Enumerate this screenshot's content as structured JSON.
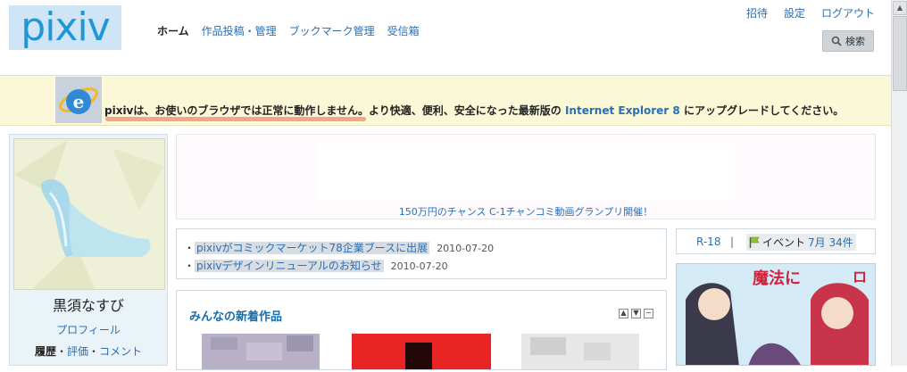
{
  "header": {
    "logo_text": "pixiv",
    "nav": [
      "ホーム",
      "作品投稿・管理",
      "ブックマーク管理",
      "受信箱"
    ],
    "toplinks": [
      "招待",
      "設定",
      "ログアウト"
    ],
    "search_label": "検索"
  },
  "notice": {
    "text_before": "pixivは、お使いのブラウザでは正常に動作しません。より快適、便利、安全になった最新版の ",
    "browser_link": "Internet Explorer 8",
    "text_after": " にアップグレードしてください。"
  },
  "profile": {
    "username": "黒須なすび",
    "profile_link": "プロフィール",
    "history": "履歴",
    "rating": "評価",
    "comment": "コメント",
    "sep": "・"
  },
  "ad": {
    "text": "150万円のチャンス C-1チャンコミ動画グランプリ開催！"
  },
  "news": [
    {
      "title": "pixivがコミックマーケット78企業ブースに出展",
      "date": "2010-07-20"
    },
    {
      "title": "pixivデザインリニューアルのお知らせ",
      "date": "2010-07-20"
    }
  ],
  "works": {
    "title": "みんなの新着作品"
  },
  "right": {
    "r18": "R-18",
    "sep": "|",
    "event_label": "イベント",
    "event_count": "7月 34件"
  },
  "colors": {
    "accent": "#2a6fb3",
    "notice_bg": "#fbf8d7",
    "underline": "#f4a48a"
  }
}
